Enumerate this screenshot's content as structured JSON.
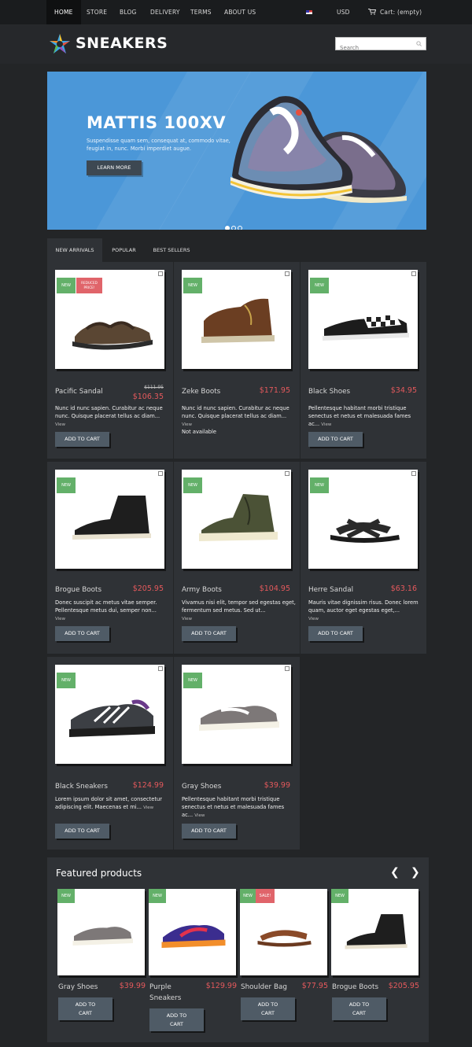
{
  "nav": {
    "items": [
      "HOME",
      "STORE",
      "BLOG",
      "DELIVERY",
      "TERMS",
      "ABOUT US"
    ],
    "currency": "USD",
    "cart": "Cart: (empty)"
  },
  "header": {
    "logo": "SNEAKERS",
    "search_placeholder": "Search"
  },
  "hero": {
    "title": "MATTIS 100XV",
    "description": "Suspendisse quam sem, consequat at, commodo vitae, feugiat in, nunc. Morbi imperdiet augue.",
    "button": "LEARN MORE"
  },
  "tabs": [
    "NEW ARRIVALS",
    "POPULAR",
    "BEST SELLERS"
  ],
  "products": [
    {
      "name": "Pacific Sandal",
      "price": "$106.35",
      "old_price": "$111.95",
      "badge": "NEW",
      "badge2": "REDUCED PRICE!",
      "desc": "Nunc id nunc sapien. Curabitur ac neque nunc. Quisque placerat tellus ac diam...",
      "view": "View",
      "note": "",
      "button": "ADD TO CART",
      "image": "sandal-icon"
    },
    {
      "name": "Zeke Boots",
      "price": "$171.95",
      "old_price": "",
      "badge": "NEW",
      "badge2": "",
      "desc": "Nunc id nunc sapien. Curabitur ac neque nunc. Quisque placerat tellus ac diam...",
      "view": "View",
      "note": "Not available",
      "button": "",
      "image": "boot-icon"
    },
    {
      "name": "Black Shoes",
      "price": "$34.95",
      "old_price": "",
      "badge": "NEW",
      "badge2": "",
      "desc": "Pellentesque habitant morbi tristique senectus et netus et malesuada fames ac...",
      "view": "View",
      "note": "",
      "button": "ADD TO CART",
      "image": "slipon-icon"
    },
    {
      "name": "Brogue Boots",
      "price": "$205.95",
      "old_price": "",
      "badge": "NEW",
      "badge2": "",
      "desc": "Donec suscipit ac metus vitae semper. Pellentesque metus dui, semper non...",
      "view": "View",
      "note": "",
      "button": "ADD TO CART",
      "image": "highboot-icon"
    },
    {
      "name": "Army Boots",
      "price": "$104.95",
      "old_price": "",
      "badge": "NEW",
      "badge2": "",
      "desc": "Vivamus nisi elit, tempor sed egestas eget, fermentum sed metus. Sed ut...",
      "view": "View",
      "note": "",
      "button": "ADD TO CART",
      "image": "highboot-icon"
    },
    {
      "name": "Herre Sandal",
      "price": "$63.16",
      "old_price": "",
      "badge": "NEW",
      "badge2": "",
      "desc": "Mauris vitae dignissim risus. Donec lorem quam, auctor eget egestas eget,...",
      "view": "View",
      "note": "",
      "button": "ADD TO CART",
      "image": "sandal-icon"
    },
    {
      "name": "Black Sneakers",
      "price": "$124.99",
      "old_price": "",
      "badge": "NEW",
      "badge2": "",
      "desc": "Lorem ipsum dolor sit amet, consectetur adipiscing elit. Maecenas et mi...",
      "view": "View",
      "note": "",
      "button": "ADD TO CART",
      "image": "sneaker-icon"
    },
    {
      "name": "Gray Shoes",
      "price": "$39.99",
      "old_price": "",
      "badge": "NEW",
      "badge2": "",
      "desc": "Pellentesque habitant morbi tristique senectus et netus et malesuada fames ac...",
      "view": "View",
      "note": "",
      "button": "ADD TO CART",
      "image": "sneaker-icon"
    }
  ],
  "featured": {
    "title": "Featured products",
    "prev": "❮",
    "next": "❯",
    "items": [
      {
        "name": "Gray Shoes",
        "price": "$39.99",
        "badge": "NEW",
        "badge2": "",
        "button_line1": "ADD TO",
        "button_line2": "CART"
      },
      {
        "name": "Purple Sneakers",
        "price": "$129.99",
        "badge": "NEW",
        "badge2": "",
        "button_line1": "ADD TO",
        "button_line2": "CART"
      },
      {
        "name": "Shoulder Bag",
        "price": "$77.95",
        "badge": "NEW",
        "badge2": "SALE!",
        "button_line1": "ADD TO",
        "button_line2": "CART"
      },
      {
        "name": "Brogue Boots",
        "price": "$205.95",
        "badge": "NEW",
        "badge2": "",
        "button_line1": "ADD TO",
        "button_line2": "CART"
      }
    ]
  },
  "colors": {
    "accent": "#e4595c",
    "new_badge": "#63b069",
    "hero": "#4b97d8",
    "button": "#4f5b66"
  }
}
